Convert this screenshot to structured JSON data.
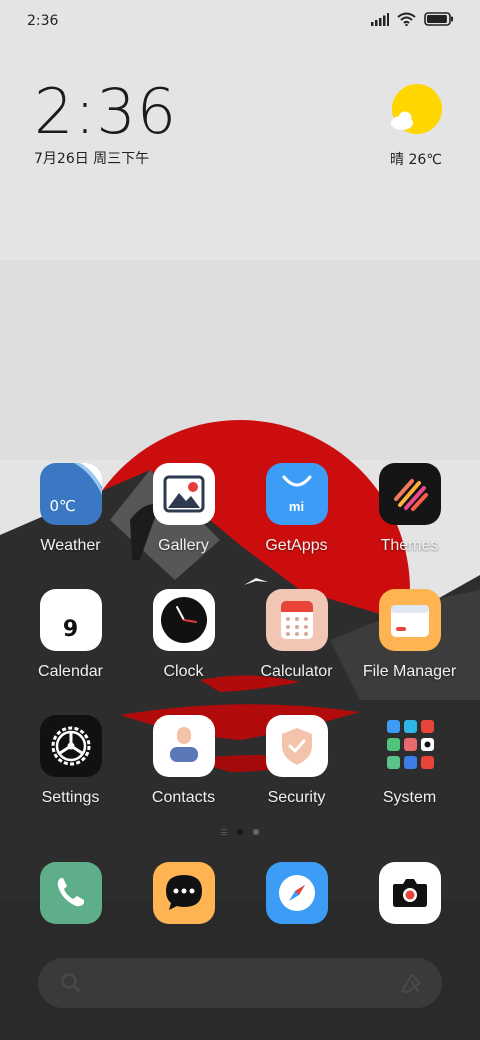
{
  "status_bar": {
    "time": "2:36",
    "icons": [
      "signal-icon",
      "wifi-icon",
      "battery-icon"
    ],
    "battery_level": 0.95
  },
  "clock_widget": {
    "time": "2:36",
    "date": "7月26日 周三下午"
  },
  "weather_widget": {
    "icon": "sunny-cloud-icon",
    "text": "晴 26℃"
  },
  "apps": [
    {
      "name": "weather",
      "label": "Weather",
      "icon_text": "0℃"
    },
    {
      "name": "gallery",
      "label": "Gallery"
    },
    {
      "name": "getapps",
      "label": "GetApps",
      "icon_text": "mi"
    },
    {
      "name": "themes",
      "label": "Themes"
    },
    {
      "name": "calendar",
      "label": "Calendar",
      "icon_text": "9"
    },
    {
      "name": "clock",
      "label": "Clock"
    },
    {
      "name": "calculator",
      "label": "Calculator"
    },
    {
      "name": "file-manager",
      "label": "File Manager"
    },
    {
      "name": "settings",
      "label": "Settings"
    },
    {
      "name": "contacts",
      "label": "Contacts"
    },
    {
      "name": "security",
      "label": "Security"
    },
    {
      "name": "system",
      "label": "System"
    }
  ],
  "page_indicator": {
    "pages": 2,
    "current": 1
  },
  "dock": [
    {
      "name": "phone",
      "icon": "phone-icon"
    },
    {
      "name": "messages",
      "icon": "messages-icon"
    },
    {
      "name": "browser",
      "icon": "compass-icon"
    },
    {
      "name": "camera",
      "icon": "camera-icon"
    }
  ],
  "search_bar": {
    "icons": [
      "search-icon",
      "assistant-icon"
    ]
  },
  "colors": {
    "red_sun": "#cc0d0d",
    "dark_ground": "#2f2f2f"
  }
}
